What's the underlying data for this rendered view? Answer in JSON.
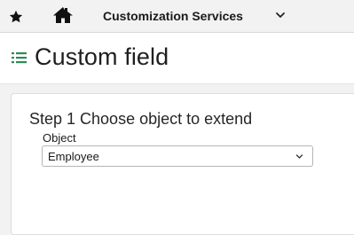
{
  "topbar": {
    "favorite_icon": "star-icon",
    "home_icon": "home-icon",
    "app_title": "Customization Services",
    "menu_icon": "chevron-down-icon"
  },
  "page": {
    "icon": "list-icon",
    "title": "Custom field"
  },
  "wizard": {
    "step_title": "Step 1 Choose object to extend",
    "object_label": "Object",
    "object_value": "Employee",
    "object_select_icon": "chevron-down-icon"
  },
  "colors": {
    "accent_icon": "#2e8b57",
    "background": "#f2f2f2",
    "panel": "#ffffff"
  }
}
